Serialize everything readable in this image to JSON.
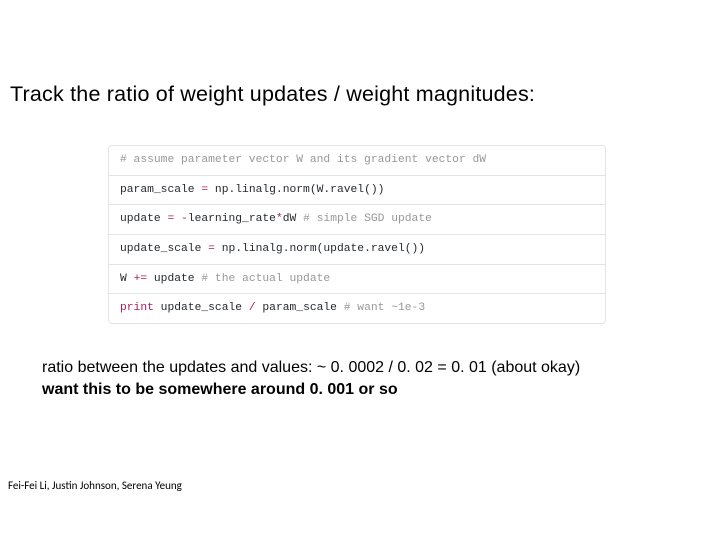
{
  "title": "Track the ratio of weight updates / weight magnitudes:",
  "code": {
    "l0_comment": "# assume parameter vector W and its gradient vector dW",
    "l1_a": "param_scale ",
    "l1_op": "=",
    "l1_b": " np.linalg.norm(W.ravel())",
    "l2_a": "update ",
    "l2_op": "= -",
    "l2_b": "learning_rate",
    "l2_op2": "*",
    "l2_c": "dW ",
    "l2_comment": "# simple SGD update",
    "l3_a": "update_scale ",
    "l3_op": "=",
    "l3_b": " np.linalg.norm(update.ravel())",
    "l4_a": "W ",
    "l4_op": "+=",
    "l4_b": " update ",
    "l4_comment": "# the actual update",
    "l5_kw": "print",
    "l5_a": " update_scale ",
    "l5_op": "/",
    "l5_b": " param_scale ",
    "l5_comment": "# want ~1e-3"
  },
  "note": {
    "line1": "ratio between the updates and values: ~ 0. 0002 / 0. 02 = 0. 01 (about okay)",
    "line2": "want this to be somewhere around 0. 001 or so"
  },
  "footer": "Fei-Fei Li, Justin Johnson, Serena Yeung"
}
